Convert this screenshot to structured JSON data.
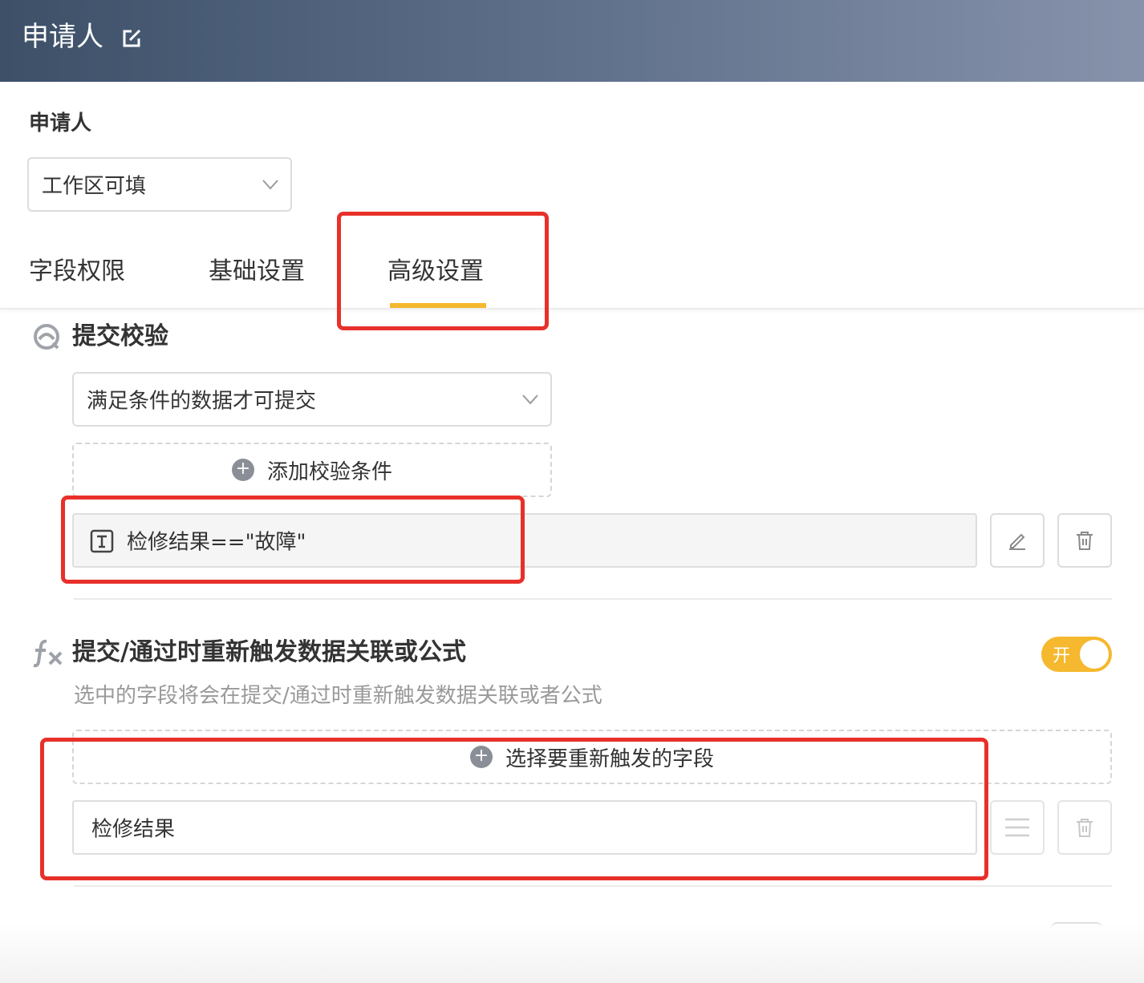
{
  "header": {
    "title": "申请人",
    "edit_icon": "edit-icon"
  },
  "permission": {
    "label": "申请人",
    "select_value": "工作区可填"
  },
  "tabs": [
    {
      "label": "字段权限",
      "active": false
    },
    {
      "label": "基础设置",
      "active": false
    },
    {
      "label": "高级设置",
      "active": true
    }
  ],
  "colors": {
    "accent": "#f5b82e",
    "highlight_box": "#e8302a",
    "header_start": "#3d5068",
    "header_end": "#8792ab"
  },
  "submit_validation": {
    "title": "提交校验",
    "icon": "validation-icon",
    "rule_select_value": "满足条件的数据才可提交",
    "add_condition_label": "添加校验条件",
    "conditions": [
      {
        "text": "检修结果==\"故障\"",
        "icon": "text-field-icon"
      }
    ]
  },
  "retrigger": {
    "title": "提交/通过时重新触发数据关联或公式",
    "icon": "fx-icon",
    "description": "选中的字段将会在提交/通过时重新触发数据关联或者公式",
    "toggle_label": "开",
    "toggle_on": true,
    "add_field_label": "选择要重新触发的字段",
    "fields": [
      {
        "name": "检修结果"
      }
    ]
  }
}
